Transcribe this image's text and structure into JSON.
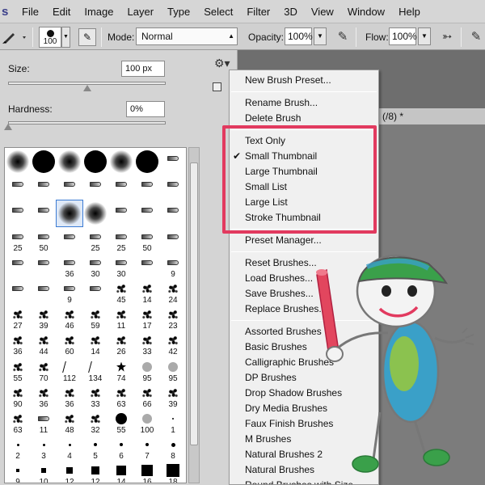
{
  "menubar": {
    "items": [
      "File",
      "Edit",
      "Image",
      "Layer",
      "Type",
      "Select",
      "Filter",
      "3D",
      "View",
      "Window",
      "Help"
    ]
  },
  "options": {
    "brush_size": "100",
    "mode_label": "Mode:",
    "mode_value": "Normal",
    "opacity_label": "Opacity:",
    "opacity_value": "100%",
    "flow_label": "Flow:",
    "flow_value": "100%"
  },
  "panel": {
    "size_label": "Size:",
    "size_value": "100 px",
    "size_slider_fraction": 0.5,
    "hardness_label": "Hardness:",
    "hardness_value": "0%",
    "hardness_slider_fraction": 0.0
  },
  "brushes": [
    {
      "g": "soft",
      "n": ""
    },
    {
      "g": "hard",
      "n": ""
    },
    {
      "g": "soft",
      "n": ""
    },
    {
      "g": "hard",
      "n": ""
    },
    {
      "g": "soft",
      "n": ""
    },
    {
      "g": "hard",
      "n": ""
    },
    {
      "g": "tip",
      "n": ""
    },
    {
      "g": "tip",
      "n": ""
    },
    {
      "g": "tip",
      "n": ""
    },
    {
      "g": "tip",
      "n": ""
    },
    {
      "g": "tip",
      "n": ""
    },
    {
      "g": "tip",
      "n": ""
    },
    {
      "g": "tip",
      "n": ""
    },
    {
      "g": "tip",
      "n": ""
    },
    {
      "g": "tip",
      "n": ""
    },
    {
      "g": "tip",
      "n": ""
    },
    {
      "g": "soft",
      "n": "",
      "sel": true
    },
    {
      "g": "soft",
      "n": ""
    },
    {
      "g": "tip",
      "n": ""
    },
    {
      "g": "tip",
      "n": ""
    },
    {
      "g": "tip",
      "n": ""
    },
    {
      "g": "tip",
      "n": "25"
    },
    {
      "g": "tip",
      "n": "50"
    },
    {
      "g": "tip",
      "n": ""
    },
    {
      "g": "tip",
      "n": "25"
    },
    {
      "g": "tip",
      "n": "25"
    },
    {
      "g": "tip",
      "n": "50"
    },
    {
      "g": "tip",
      "n": ""
    },
    {
      "g": "tip",
      "n": ""
    },
    {
      "g": "tip",
      "n": ""
    },
    {
      "g": "tip",
      "n": "36"
    },
    {
      "g": "tip",
      "n": "30"
    },
    {
      "g": "tip",
      "n": "30"
    },
    {
      "g": "tip",
      "n": ""
    },
    {
      "g": "tip",
      "n": "9"
    },
    {
      "g": "tip",
      "n": ""
    },
    {
      "g": "tip",
      "n": ""
    },
    {
      "g": "tip",
      "n": "9"
    },
    {
      "g": "tip",
      "n": ""
    },
    {
      "g": "splat",
      "n": "45"
    },
    {
      "g": "splat",
      "n": "14"
    },
    {
      "g": "splat",
      "n": "24"
    },
    {
      "g": "splat",
      "n": "27"
    },
    {
      "g": "splat",
      "n": "39"
    },
    {
      "g": "splat",
      "n": "46"
    },
    {
      "g": "splat",
      "n": "59"
    },
    {
      "g": "splat",
      "n": "11"
    },
    {
      "g": "splat",
      "n": "17"
    },
    {
      "g": "splat",
      "n": "23"
    },
    {
      "g": "splat",
      "n": "36"
    },
    {
      "g": "splat",
      "n": "44"
    },
    {
      "g": "splat",
      "n": "60"
    },
    {
      "g": "splat",
      "n": "14"
    },
    {
      "g": "splat",
      "n": "26"
    },
    {
      "g": "splat",
      "n": "33"
    },
    {
      "g": "splat",
      "n": "42"
    },
    {
      "g": "splat",
      "n": "55"
    },
    {
      "g": "splat",
      "n": "70"
    },
    {
      "g": "fan",
      "n": "112"
    },
    {
      "g": "fan",
      "n": "134"
    },
    {
      "g": "leaf",
      "n": "74"
    },
    {
      "g": "grey-round",
      "n": "95"
    },
    {
      "g": "grey-round",
      "n": "95"
    },
    {
      "g": "splat",
      "n": "90"
    },
    {
      "g": "splat",
      "n": "36"
    },
    {
      "g": "splat",
      "n": "36"
    },
    {
      "g": "splat",
      "n": "33"
    },
    {
      "g": "splat",
      "n": "63"
    },
    {
      "g": "splat",
      "n": "66"
    },
    {
      "g": "splat",
      "n": "39"
    },
    {
      "g": "splat",
      "n": "63"
    },
    {
      "g": "tip",
      "n": "11"
    },
    {
      "g": "splat",
      "n": "48"
    },
    {
      "g": "splat",
      "n": "32"
    },
    {
      "g": "hard",
      "n": "55"
    },
    {
      "g": "grey-round",
      "n": "100"
    },
    {
      "g": "dot1",
      "n": "1"
    },
    {
      "g": "dot2",
      "n": "2"
    },
    {
      "g": "dot2",
      "n": "3"
    },
    {
      "g": "dot2",
      "n": "4"
    },
    {
      "g": "dot3",
      "n": "5"
    },
    {
      "g": "dot3",
      "n": "6"
    },
    {
      "g": "dot3",
      "n": "7"
    },
    {
      "g": "dot4",
      "n": "8"
    },
    {
      "g": "sq1",
      "n": "9"
    },
    {
      "g": "sq2",
      "n": "10"
    },
    {
      "g": "sq3",
      "n": "12"
    },
    {
      "g": "sq4",
      "n": "12"
    },
    {
      "g": "sq5",
      "n": "14"
    },
    {
      "g": "sq6",
      "n": "16"
    },
    {
      "g": "sq7",
      "n": "18"
    }
  ],
  "document_tab": "(/8) *",
  "context_menu": {
    "group1": [
      "New Brush Preset..."
    ],
    "group2": [
      "Rename Brush...",
      "Delete Brush"
    ],
    "group3": [
      {
        "label": "Text Only",
        "checked": false
      },
      {
        "label": "Small Thumbnail",
        "checked": true
      },
      {
        "label": "Large Thumbnail",
        "checked": false
      },
      {
        "label": "Small List",
        "checked": false
      },
      {
        "label": "Large List",
        "checked": false
      },
      {
        "label": "Stroke Thumbnail",
        "checked": false
      }
    ],
    "group4": [
      "Preset Manager..."
    ],
    "group5": [
      "Reset Brushes...",
      "Load Brushes...",
      "Save Brushes...",
      "Replace Brushes..."
    ],
    "group6": [
      "Assorted Brushes",
      "Basic Brushes",
      "Calligraphic Brushes",
      "DP Brushes",
      "Drop Shadow Brushes",
      "Dry Media Brushes",
      "Faux Finish Brushes",
      "M Brushes",
      "Natural Brushes 2",
      "Natural Brushes",
      "Round Brushes with Size"
    ]
  },
  "colors": {
    "highlight": "#e23a5f",
    "selected_cell": "#3b7bd4"
  }
}
